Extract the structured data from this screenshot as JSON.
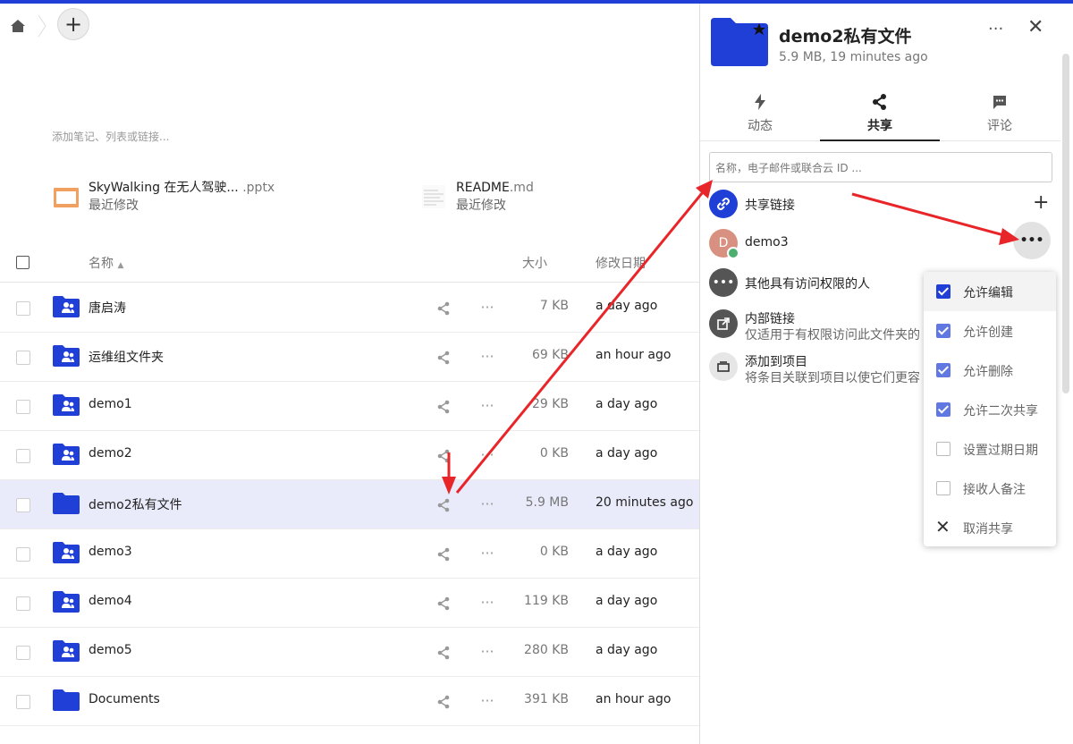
{
  "header": {
    "breadcrumb_home": "home-icon",
    "new_button_label": "+"
  },
  "notes": {
    "placeholder": "添加笔记、列表或链接..."
  },
  "recent": [
    {
      "name": "SkyWalking 在无人驾驶...",
      "ext": " .pptx",
      "sub": "最近修改"
    },
    {
      "name": "README",
      "ext": ".md",
      "sub": "最近修改"
    }
  ],
  "table": {
    "headers": {
      "name": "名称",
      "size": "大小",
      "modified": "修改日期"
    },
    "rows": [
      {
        "name": "唐启涛",
        "size": "7 KB",
        "date": "a day ago",
        "shared": true
      },
      {
        "name": "运维组文件夹",
        "size": "69 KB",
        "date": "an hour ago",
        "shared": true
      },
      {
        "name": "demo1",
        "size": "29 KB",
        "date": "a day ago",
        "shared": true
      },
      {
        "name": "demo2",
        "size": "0 KB",
        "date": "a day ago",
        "shared": true
      },
      {
        "name": "demo2私有文件",
        "size": "5.9 MB",
        "date": "20 minutes ago",
        "shared": false,
        "selected": true
      },
      {
        "name": "demo3",
        "size": "0 KB",
        "date": "a day ago",
        "shared": true
      },
      {
        "name": "demo4",
        "size": "119 KB",
        "date": "a day ago",
        "shared": true
      },
      {
        "name": "demo5",
        "size": "280 KB",
        "date": "a day ago",
        "shared": true
      },
      {
        "name": "Documents",
        "size": "391 KB",
        "date": "an hour ago",
        "shared": false
      }
    ]
  },
  "sidebar": {
    "title": "demo2私有文件",
    "subtitle": "5.9 MB, 19 minutes ago",
    "more": "···",
    "close": "✕",
    "tabs": [
      {
        "label": "动态",
        "icon": "activity-icon"
      },
      {
        "label": "共享",
        "icon": "share-icon",
        "active": true
      },
      {
        "label": "评论",
        "icon": "comment-icon"
      }
    ],
    "search_placeholder": "名称，电子邮件或联合云 ID ...",
    "share_link": "共享链接",
    "share_link_add": "+",
    "user": {
      "initial": "D",
      "name": "demo3"
    },
    "others": "其他具有访问权限的人",
    "internal_link": {
      "title": "内部链接",
      "sub": "仅适用于有权限访问此文件夹的"
    },
    "add_project": {
      "title": "添加到项目",
      "sub": "将条目关联到项目以使它们更容"
    }
  },
  "menu": {
    "items": [
      {
        "label": "允许编辑",
        "checked": true
      },
      {
        "label": "允许创建",
        "checked": true
      },
      {
        "label": "允许删除",
        "checked": true
      },
      {
        "label": "允许二次共享",
        "checked": true
      },
      {
        "label": "设置过期日期",
        "checked": false
      },
      {
        "label": "接收人备注",
        "checked": false
      }
    ],
    "unshare": "取消共享"
  },
  "colors": {
    "accent": "#1f3fd6",
    "selected_row": "#e9ebfa",
    "arrow": "#e8262a"
  }
}
